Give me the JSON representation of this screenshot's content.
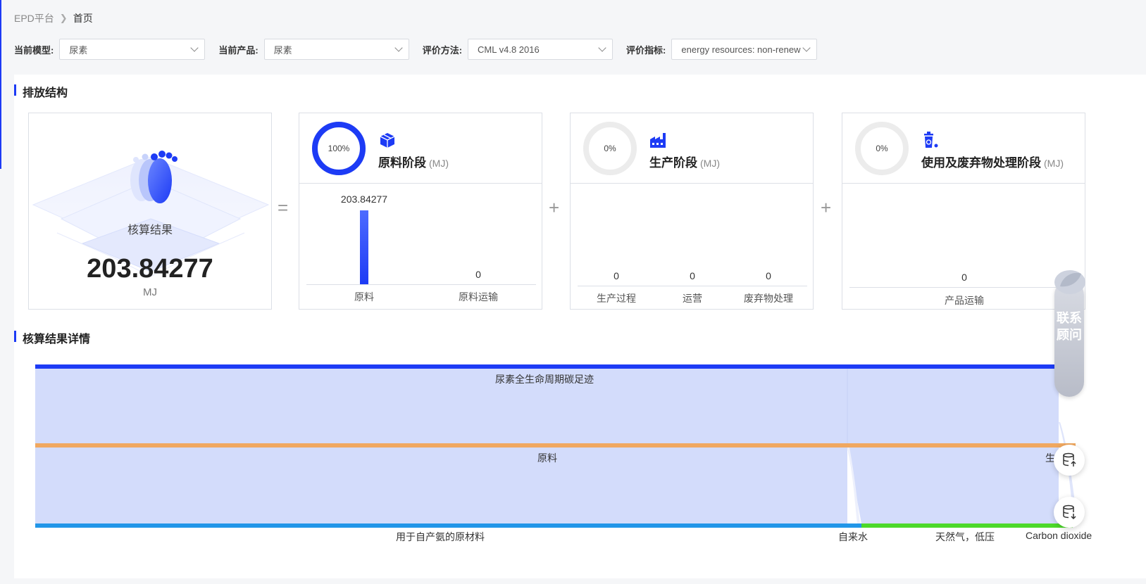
{
  "breadcrumb": {
    "root": "EPD平台",
    "current": "首页"
  },
  "filters": [
    {
      "label": "当前模型:",
      "value": "尿素"
    },
    {
      "label": "当前产品:",
      "value": "尿素"
    },
    {
      "label": "评价方法:",
      "value": "CML v4.8 2016"
    },
    {
      "label": "评价指标:",
      "value": "energy resources: non-renew"
    }
  ],
  "emission": {
    "title": "排放结构",
    "result": {
      "label": "核算结果",
      "value": "203.84277",
      "unit": "MJ"
    },
    "operators": [
      "=",
      "+",
      "+"
    ],
    "stages": [
      {
        "name": "原料阶段",
        "unit": "(MJ)",
        "percent_label": "100%",
        "percent": 100,
        "icon": "boxes-icon",
        "values": [
          {
            "label": "原料",
            "value": "203.84277",
            "num": 203.84277
          },
          {
            "label": "原料运输",
            "value": "0",
            "num": 0
          }
        ]
      },
      {
        "name": "生产阶段",
        "unit": "(MJ)",
        "percent_label": "0%",
        "percent": 0,
        "icon": "factory-icon",
        "values": [
          {
            "label": "生产过程",
            "value": "0",
            "num": 0
          },
          {
            "label": "运营",
            "value": "0",
            "num": 0
          },
          {
            "label": "废弃物处理",
            "value": "0",
            "num": 0
          }
        ]
      },
      {
        "name": "使用及废弃物处理阶段",
        "unit": "(MJ)",
        "percent_label": "0%",
        "percent": 0,
        "icon": "recycle-bin-icon",
        "values": [
          {
            "label": "产品运输",
            "value": "0",
            "num": 0
          }
        ]
      }
    ]
  },
  "detail": {
    "title": "核算结果详情",
    "sankey_labels": {
      "root": "尿素全生命周期碳足迹",
      "raw": "原料",
      "prod_partial": "生",
      "ammonia": "用于自产氨的原材料",
      "water": "自来水",
      "gas": "天然气，低压",
      "co2": "Carbon dioxide"
    }
  },
  "colors": {
    "accent": "#1d3bf5",
    "raw_node": "#f0a860",
    "ammonia_node": "#2196e8",
    "gas_node": "#4cd92a",
    "flow": "#d3dcfb"
  },
  "side": {
    "consult_label": "联系顾问",
    "upload_icon": "database-upload-icon",
    "download_icon": "database-download-icon"
  }
}
